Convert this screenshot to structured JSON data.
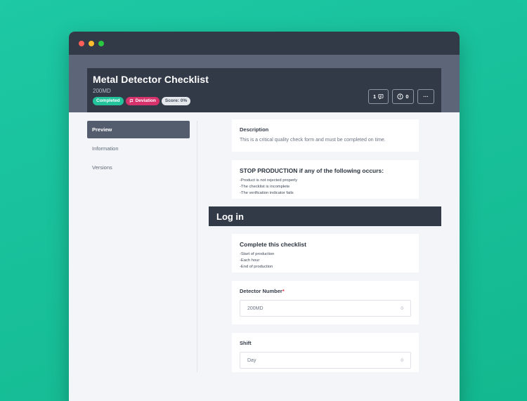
{
  "window": {
    "title": "Metal Detector Checklist",
    "code": "200MD",
    "badges": {
      "completed": "Completed",
      "deviation": "Deviation",
      "score": "Score: 0%"
    },
    "actions": {
      "comments_count": "1",
      "alerts_count": "0",
      "more": "···"
    }
  },
  "sidebar": {
    "items": [
      {
        "label": "Preview",
        "active": true
      },
      {
        "label": "Information",
        "active": false
      },
      {
        "label": "Versions",
        "active": false
      }
    ]
  },
  "main": {
    "description": {
      "label": "Description",
      "text": "This is a critical quality check form and must be completed on time."
    },
    "stop": {
      "heading": "STOP PRODUCTION if any of the following occurs:",
      "lines": [
        "-Product is not rejected properly",
        "-The checklist is incomplete",
        "-The verification indicator fails"
      ]
    },
    "section_title": "Log in",
    "complete": {
      "heading": "Complete this checklist",
      "lines": [
        "-Start of production",
        "-Each hour",
        "-End of production"
      ]
    },
    "detector": {
      "label": "Detector Number",
      "required_mark": "*",
      "value": "200MD",
      "count": "0"
    },
    "shift": {
      "label": "Shift",
      "value": "Day",
      "count": "0"
    }
  }
}
